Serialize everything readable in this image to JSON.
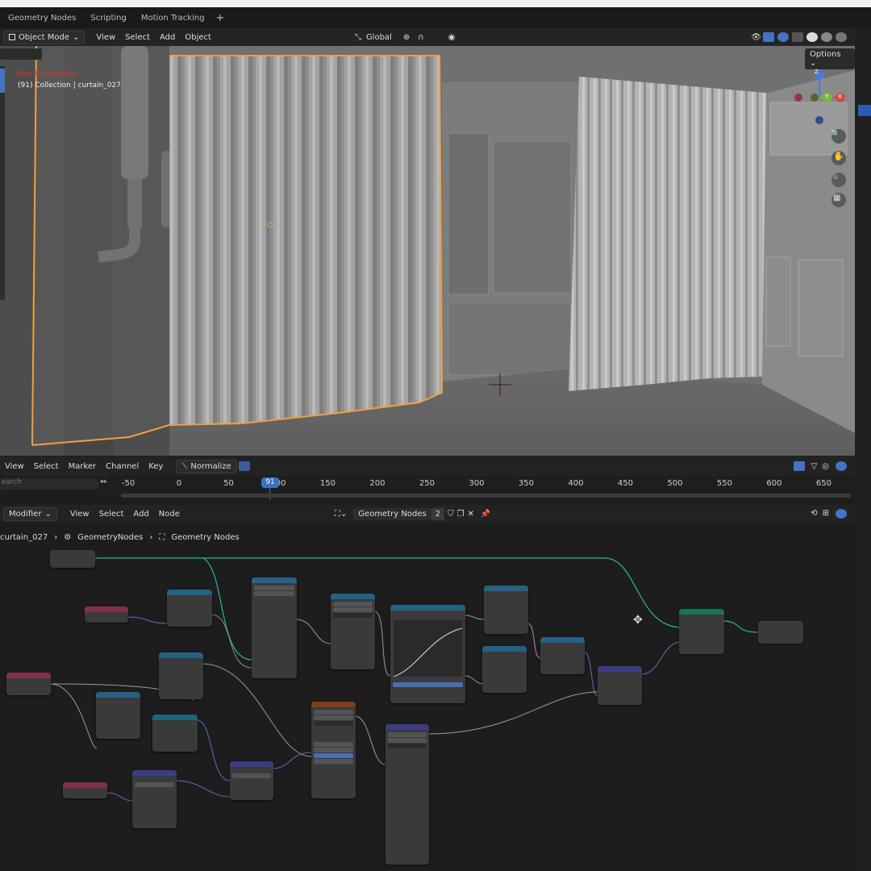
{
  "workspace_tabs": [
    "Geometry Nodes",
    "Scripting",
    "Motion Tracking"
  ],
  "add_tab": "+",
  "viewport_header": {
    "mode": "Object Mode",
    "menus": [
      "View",
      "Select",
      "Add",
      "Object"
    ],
    "orientation": "Global",
    "options": "Options"
  },
  "viewport_overlay": {
    "view_name": "User Perspective",
    "collection": "(91) Collection | curtain_027"
  },
  "gizmo": {
    "x": "X",
    "y": "Y",
    "z": "Z"
  },
  "timeline": {
    "menus": [
      "View",
      "Select",
      "Marker",
      "Channel",
      "Key"
    ],
    "normalize": "Normalize",
    "search_placeholder": "earch",
    "current_frame": "91",
    "ticks": [
      "-50",
      "0",
      "50",
      "100",
      "150",
      "200",
      "250",
      "300",
      "350",
      "400",
      "450",
      "500",
      "550",
      "600",
      "650"
    ]
  },
  "node_editor": {
    "editor_type": "Modifier",
    "menus": [
      "View",
      "Select",
      "Add",
      "Node"
    ],
    "tree_name": "Geometry Nodes",
    "users": "2",
    "breadcrumb": [
      "curtain_027",
      "GeometryNodes",
      "Geometry Nodes"
    ]
  },
  "colors": {
    "geometry_header": "#1d725e",
    "vector_header": "#3c3c83",
    "converter_header": "#246283",
    "input_header": "#83314a",
    "texture_header": "#7c3e1b",
    "geometry_link": "#2bb79a",
    "selection_outline": "#f0a040"
  }
}
